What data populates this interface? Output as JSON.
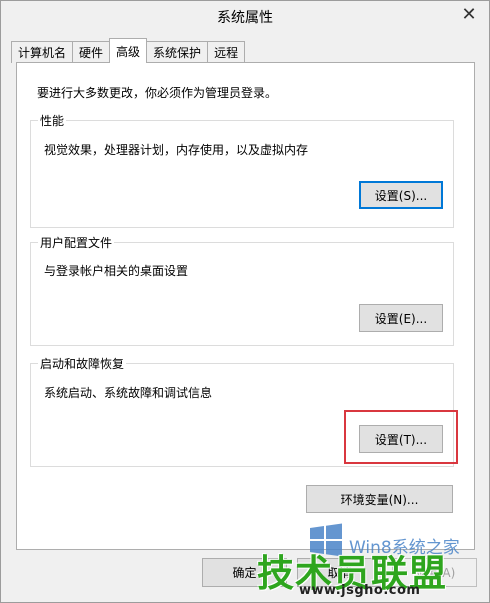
{
  "window": {
    "title": "系统属性",
    "close_glyph": "✕"
  },
  "tabs": [
    {
      "label": "计算机名"
    },
    {
      "label": "硬件"
    },
    {
      "label": "高级"
    },
    {
      "label": "系统保护"
    },
    {
      "label": "远程"
    }
  ],
  "active_tab": "高级",
  "notice": "要进行大多数更改，你必须作为管理员登录。",
  "groups": {
    "performance": {
      "title": "性能",
      "description": "视觉效果，处理器计划，内存使用，以及虚拟内存",
      "button": "设置(S)..."
    },
    "user_profiles": {
      "title": "用户配置文件",
      "description": "与登录帐户相关的桌面设置",
      "button": "设置(E)..."
    },
    "startup_recovery": {
      "title": "启动和故障恢复",
      "description": "系统启动、系统故障和调试信息",
      "button": "设置(T)..."
    }
  },
  "env_button": "环境变量(N)...",
  "footer": {
    "ok": "确定",
    "cancel": "取消",
    "apply": "应用(A)"
  },
  "watermark": {
    "sub": "Win8系统之家",
    "main": "技术员联盟",
    "url": "www.jsgho.com"
  },
  "colors": {
    "highlight": "#d9373f",
    "focus_border": "#0078d7",
    "watermark_green": "#2ea51e",
    "watermark_blue": "#4a84c8"
  }
}
